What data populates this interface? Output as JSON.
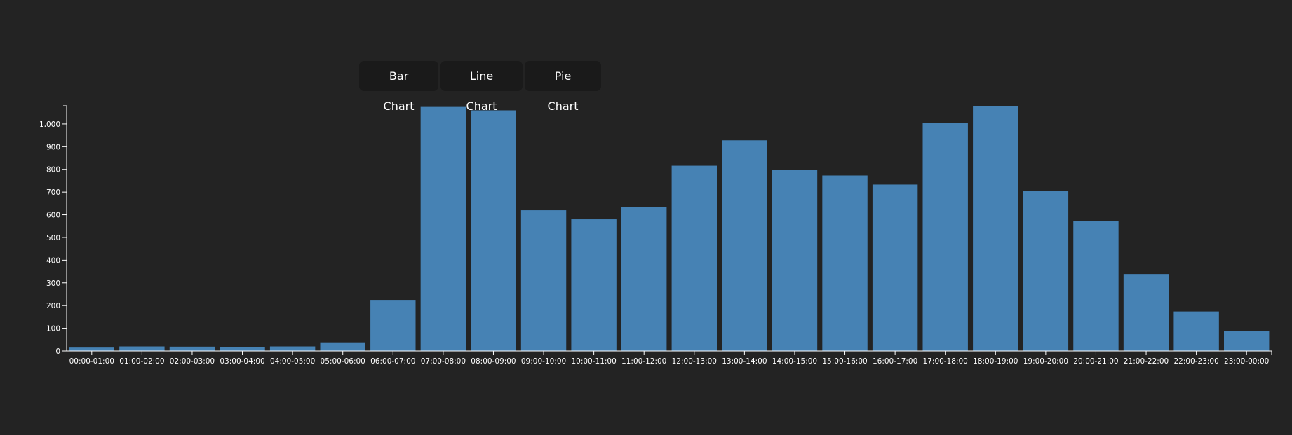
{
  "toolbar": {
    "buttons": [
      {
        "label": "Bar Chart"
      },
      {
        "label": "Line Chart"
      },
      {
        "label": "Pie Chart"
      }
    ]
  },
  "chart_data": {
    "type": "bar",
    "categories": [
      "00:00-01:00",
      "01:00-02:00",
      "02:00-03:00",
      "03:00-04:00",
      "04:00-05:00",
      "05:00-06:00",
      "06:00-07:00",
      "07:00-08:00",
      "08:00-09:00",
      "09:00-10:00",
      "10:00-11:00",
      "11:00-12:00",
      "12:00-13:00",
      "13:00-14:00",
      "14:00-15:00",
      "15:00-16:00",
      "16:00-17:00",
      "17:00-18:00",
      "18:00-19:00",
      "19:00-20:00",
      "20:00-21:00",
      "21:00-22:00",
      "22:00-23:00",
      "23:00-00:00"
    ],
    "values": [
      15,
      20,
      19,
      17,
      20,
      38,
      225,
      1075,
      1060,
      620,
      580,
      633,
      816,
      928,
      798,
      773,
      733,
      1005,
      1080,
      705,
      573,
      339,
      174,
      87
    ],
    "title": "",
    "xlabel": "",
    "ylabel": "",
    "ylim": [
      0,
      1080
    ],
    "yticks": [
      0,
      100,
      200,
      300,
      400,
      500,
      600,
      700,
      800,
      900,
      1000
    ],
    "ytick_labels": [
      "0",
      "100",
      "200",
      "300",
      "400",
      "500",
      "600",
      "700",
      "800",
      "900",
      "1,000"
    ],
    "grid": false,
    "bar_color": "#4682b4"
  }
}
